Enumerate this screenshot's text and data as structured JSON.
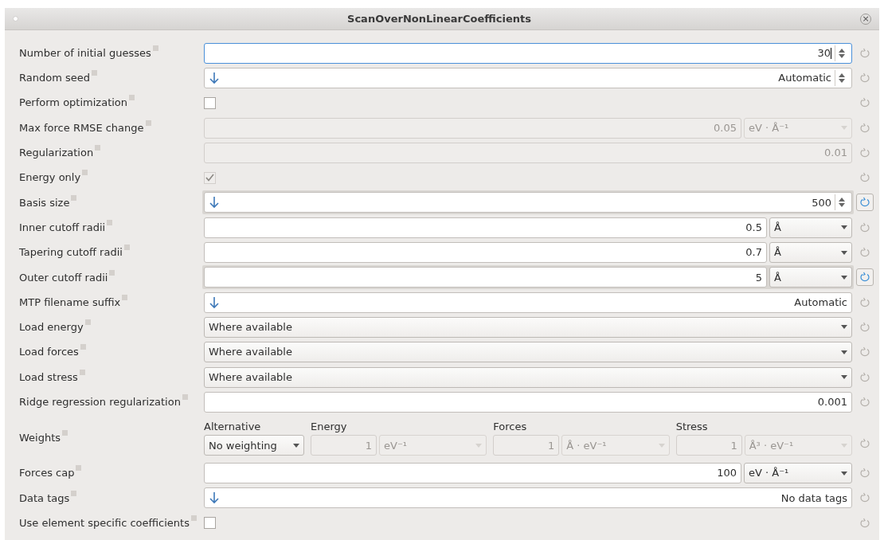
{
  "window": {
    "title": "ScanOverNonLinearCoefficients",
    "close": "×"
  },
  "rows": [
    {
      "label": "Number of initial guesses",
      "kind": "number",
      "value": "30",
      "arrow": false,
      "spinner": true,
      "disabled": false,
      "focused": true,
      "modified": false
    },
    {
      "label": "Random seed",
      "kind": "number",
      "value": "Automatic",
      "arrow": true,
      "spinner": true,
      "disabled": false,
      "focused": false,
      "modified": false
    },
    {
      "label": "Perform optimization",
      "kind": "checkbox",
      "checked": false,
      "disabled": false,
      "modified": false
    },
    {
      "label": "Max force RMSE change",
      "kind": "number",
      "value": "0.05",
      "unit": "eV · Å⁻¹",
      "arrow": false,
      "spinner": false,
      "disabled": true,
      "focused": false,
      "modified": false
    },
    {
      "label": "Regularization",
      "kind": "number",
      "value": "0.01",
      "arrow": false,
      "spinner": false,
      "disabled": true,
      "focused": false,
      "modified": false
    },
    {
      "label": "Energy only",
      "kind": "checkbox",
      "checked": true,
      "disabled": true,
      "modified": false
    },
    {
      "label": "Basis size",
      "kind": "number",
      "value": "500",
      "arrow": true,
      "spinner": true,
      "disabled": false,
      "focused": false,
      "modified": true
    },
    {
      "label": "Inner cutoff radii",
      "kind": "number",
      "value": "0.5",
      "unit": "Å",
      "arrow": false,
      "spinner": false,
      "disabled": false,
      "focused": false,
      "modified": false
    },
    {
      "label": "Tapering cutoff radii",
      "kind": "number",
      "value": "0.7",
      "unit": "Å",
      "arrow": false,
      "spinner": false,
      "disabled": false,
      "focused": false,
      "modified": false
    },
    {
      "label": "Outer cutoff radii",
      "kind": "number",
      "value": "5",
      "unit": "Å",
      "arrow": false,
      "spinner": false,
      "disabled": false,
      "focused": false,
      "modified": true
    },
    {
      "label": "MTP filename suffix",
      "kind": "number",
      "value": "Automatic",
      "arrow": true,
      "spinner": false,
      "disabled": false,
      "focused": false,
      "modified": false
    },
    {
      "label": "Load energy",
      "kind": "combo",
      "value": "Where available",
      "disabled": false,
      "modified": false
    },
    {
      "label": "Load forces",
      "kind": "combo",
      "value": "Where available",
      "disabled": false,
      "modified": false
    },
    {
      "label": "Load stress",
      "kind": "combo",
      "value": "Where available",
      "disabled": false,
      "modified": false
    },
    {
      "label": "Ridge regression regularization",
      "kind": "number",
      "value": "0.001",
      "arrow": false,
      "spinner": false,
      "disabled": false,
      "focused": false,
      "modified": false
    },
    {
      "label": "Weights",
      "kind": "weights",
      "modified": false,
      "alternative": {
        "header": "Alternative",
        "value": "No weighting"
      },
      "columns": [
        {
          "header": "Energy",
          "value": "1",
          "unit": "eV⁻¹",
          "disabled": true
        },
        {
          "header": "Forces",
          "value": "1",
          "unit": "Å · eV⁻¹",
          "disabled": true
        },
        {
          "header": "Stress",
          "value": "1",
          "unit": "Å³ · eV⁻¹",
          "disabled": true
        }
      ]
    },
    {
      "label": "Forces cap",
      "kind": "number",
      "value": "100",
      "unit": "eV · Å⁻¹",
      "arrow": false,
      "spinner": false,
      "disabled": false,
      "focused": false,
      "modified": false
    },
    {
      "label": "Data tags",
      "kind": "number",
      "value": "No data tags",
      "arrow": true,
      "spinner": false,
      "disabled": false,
      "focused": false,
      "modified": false
    },
    {
      "label": "Use element specific coefficients",
      "kind": "checkbox",
      "checked": false,
      "disabled": false,
      "modified": false
    }
  ]
}
